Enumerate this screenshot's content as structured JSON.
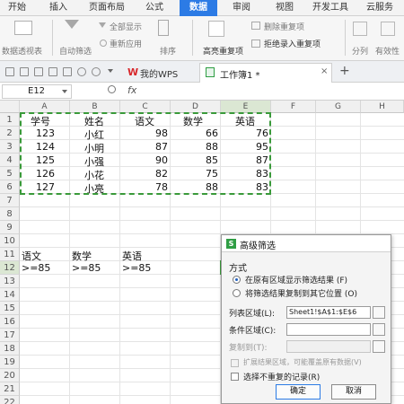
{
  "ribbon_tabs": [
    "开始",
    "插入",
    "页面布局",
    "公式",
    "数据",
    "审阅",
    "视图",
    "开发工具",
    "云服务"
  ],
  "ribbon_items": {
    "pivot_table": "数据透视表",
    "auto_filter": "自动筛选",
    "show_all": "全部显示",
    "reapply": "重新应用",
    "sort": "排序",
    "highlight_dup": "高亮重复项",
    "delete_dup": "删除重复项",
    "reject_dup": "拒绝录入重复项",
    "split": "分列",
    "validity": "有效性"
  },
  "doc_tabs": {
    "wps": "我的WPS",
    "workbook": "工作簿1 *"
  },
  "formula_bar": {
    "cell_ref": "E12",
    "fx": "fx",
    "content": ""
  },
  "columns": [
    "A",
    "B",
    "C",
    "D",
    "E",
    "F",
    "G",
    "H"
  ],
  "rows": [
    "1",
    "2",
    "3",
    "4",
    "5",
    "6",
    "7",
    "8",
    "9",
    "10",
    "11",
    "12",
    "13",
    "14",
    "15",
    "16",
    "17",
    "18",
    "19",
    "20",
    "21",
    "22"
  ],
  "table": {
    "headers": [
      "学号",
      "姓名",
      "语文",
      "数学",
      "英语"
    ],
    "records": [
      [
        "123",
        "小红",
        "98",
        "66",
        "76"
      ],
      [
        "124",
        "小明",
        "87",
        "88",
        "95"
      ],
      [
        "125",
        "小强",
        "90",
        "85",
        "87"
      ],
      [
        "126",
        "小花",
        "82",
        "75",
        "83"
      ],
      [
        "127",
        "小亮",
        "78",
        "88",
        "83"
      ]
    ]
  },
  "criteria": {
    "headers": [
      "语文",
      "数学",
      "英语"
    ],
    "values": [
      ">=85",
      ">=85",
      ">=85"
    ]
  },
  "dialog": {
    "title": "高级筛选",
    "group_label": "方式",
    "option_in_place": "在原有区域显示筛选结果 (F)",
    "option_copy": "将筛选结果复制到其它位置 (O)",
    "list_range_label": "列表区域(L):",
    "list_range_value": "Sheet1!$A$1:$E$6",
    "criteria_label": "条件区域(C):",
    "criteria_value": "",
    "copy_to_label": "复制到(T):",
    "copy_to_value": "",
    "expand_label": "扩展结果区域，可能覆盖原有数据(V)",
    "unique_label": "选择不重复的记录(R)",
    "ok": "确定",
    "cancel": "取消"
  },
  "colors": {
    "accent": "#2c7be5",
    "selection": "#3a9a3a",
    "wps_red": "#d8282c"
  }
}
